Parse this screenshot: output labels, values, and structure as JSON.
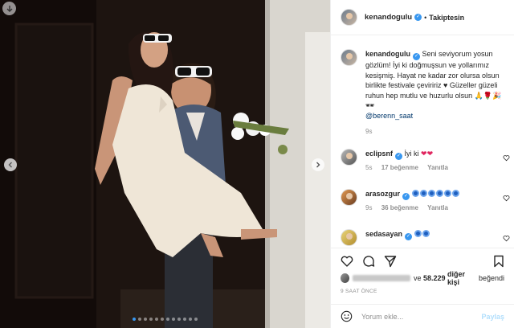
{
  "post": {
    "username": "kenandogulu",
    "follow_status": "Takiptesin",
    "separator": "•"
  },
  "caption": {
    "username": "kenandogulu",
    "text": "Seni seviyorum yosun gözlüm! İyi ki doğmuşsun ve yollarımız kesişmiş. Hayat ne kadar zor olursa olsun birlikte festivale çeviririz ♥ Güzeller güzeli ruhun hep mutlu ve huzurlu olsun 🙏🌹🎉🕶",
    "mention": "@berenn_saat",
    "time": "9s"
  },
  "comments": [
    {
      "username": "eclipsnf",
      "text": "İyi ki",
      "emoji": "❤❤",
      "time": "5s",
      "likes": "17 beğenme",
      "reply": "Yanıtla"
    },
    {
      "username": "arasozgur",
      "text": "",
      "emoji_count": 6,
      "time": "9s",
      "likes": "36 beğenme",
      "reply": "Yanıtla"
    },
    {
      "username": "sedasayan",
      "text": "",
      "emoji_count": 2
    }
  ],
  "likes": {
    "prefix": "ve",
    "count": "58.229",
    "suffix": "diğer kişi",
    "verb": "beğendi"
  },
  "time_ago": "9 SAAT ÖNCE",
  "add_comment": {
    "placeholder": "Yorum ekle...",
    "post_label": "Paylaş"
  },
  "icons": {
    "top_left": "download-icon",
    "prev": "chevron-left-icon",
    "next": "chevron-right-icon",
    "like": "heart-icon",
    "comment": "comment-icon",
    "share": "share-icon",
    "save": "bookmark-icon",
    "emoji": "smiley-icon"
  },
  "colors": {
    "link": "#00376b",
    "verified": "#3897f0",
    "active_dot": "#3897f0",
    "post_disabled": "#b2dffc"
  },
  "carousel": {
    "slides": 12,
    "active": 1
  }
}
